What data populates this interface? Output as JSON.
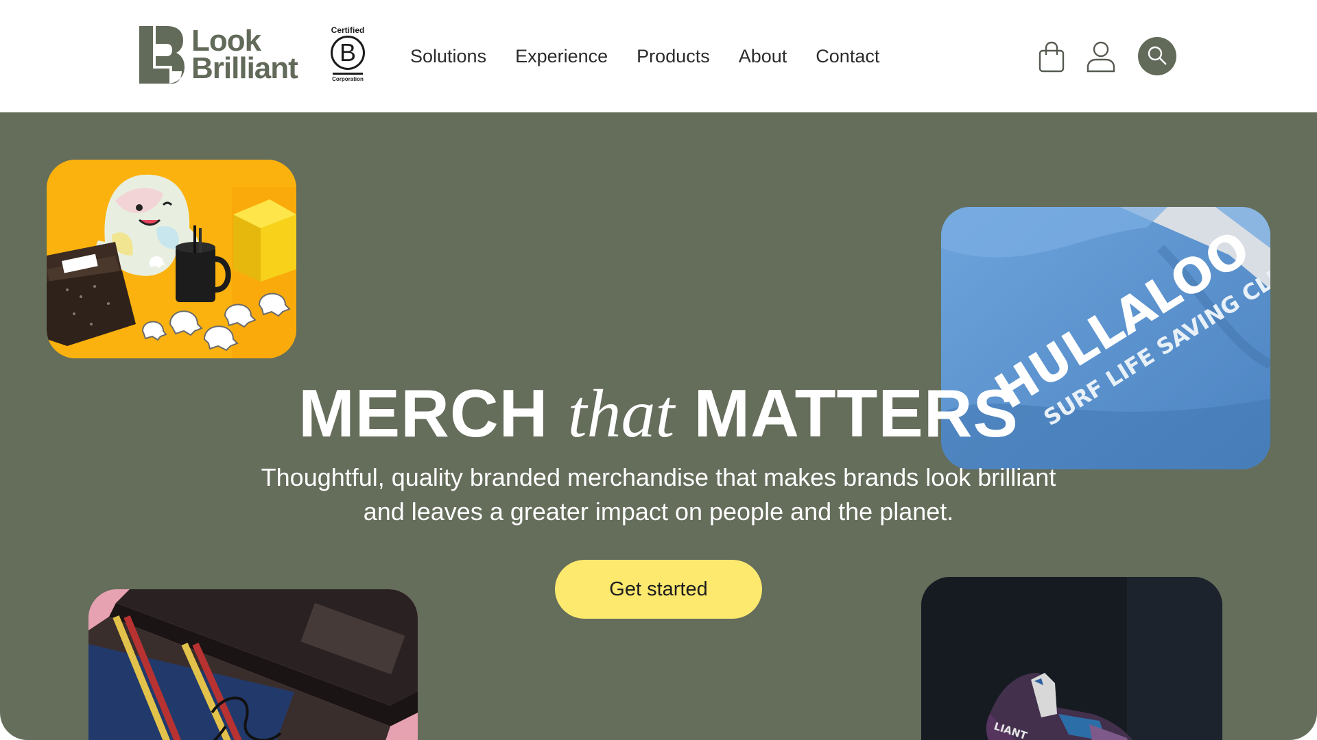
{
  "brand": {
    "line1": "Look",
    "line2": "Brilliant",
    "certification": {
      "top": "Certified",
      "letter": "B",
      "bottom": "Corporation"
    }
  },
  "nav": {
    "items": [
      {
        "label": "Solutions"
      },
      {
        "label": "Experience"
      },
      {
        "label": "Products"
      },
      {
        "label": "About"
      },
      {
        "label": "Contact"
      }
    ]
  },
  "header_icons": [
    "shopping-bag-icon",
    "user-icon",
    "search-icon"
  ],
  "hero": {
    "headline_part1": "MERCH",
    "headline_script": "that",
    "headline_part2": "MATTERS",
    "subtitle_line1": "Thoughtful, quality branded merchandise that makes brands look brilliant",
    "subtitle_line2": "and leaves a greater impact on people and the planet.",
    "cta_label": "Get started",
    "photo2_print_line1": "HULLALOO",
    "photo2_print_line2": "SURF LIFE SAVING CLUB",
    "photo4_print": "LIANT"
  },
  "colors": {
    "brand_green": "#626a59",
    "hero_bg": "#656d5b",
    "cta_yellow": "#fde96e"
  }
}
